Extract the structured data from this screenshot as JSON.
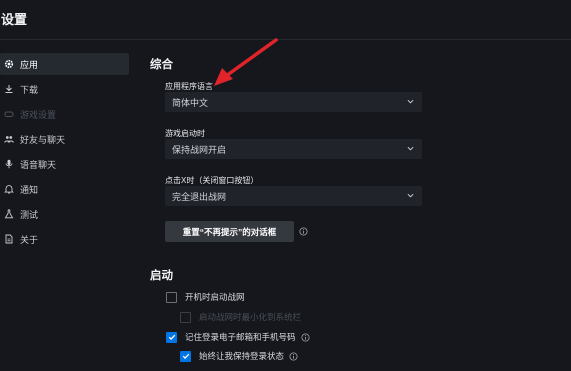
{
  "window": {
    "title": "设置"
  },
  "sidebar": {
    "items": [
      {
        "label": "应用",
        "icon": "gear-icon",
        "active": true
      },
      {
        "label": "下载",
        "icon": "download-icon"
      },
      {
        "label": "游戏设置",
        "icon": "gamepad-icon",
        "disabled": true
      },
      {
        "label": "好友与聊天",
        "icon": "friends-icon"
      },
      {
        "label": "语音聊天",
        "icon": "microphone-icon"
      },
      {
        "label": "通知",
        "icon": "bell-icon"
      },
      {
        "label": "测试",
        "icon": "flask-icon"
      },
      {
        "label": "关于",
        "icon": "document-icon"
      }
    ]
  },
  "general": {
    "title": "综合",
    "language_label": "应用程序语言",
    "language_value": "简体中文",
    "launch_label": "游戏启动时",
    "launch_value": "保持战网开启",
    "close_label": "点击X时（关闭窗口按钮）",
    "close_value": "完全退出战网",
    "reset_button": "重置“不再提示”的对话框"
  },
  "startup": {
    "title": "启动",
    "options": [
      {
        "label": "开机时启动战网",
        "checked": false
      },
      {
        "label": "启动战网时最小化到系统栏",
        "checked": false,
        "disabled": true
      },
      {
        "label": "记住登录电子邮箱和手机号码",
        "checked": true,
        "info": true
      },
      {
        "label": "始终让我保持登录状态",
        "checked": true,
        "info": true
      }
    ]
  },
  "colors": {
    "accent": "#0074e0",
    "background": "#15171c",
    "annotation_arrow": "#e0242a"
  }
}
